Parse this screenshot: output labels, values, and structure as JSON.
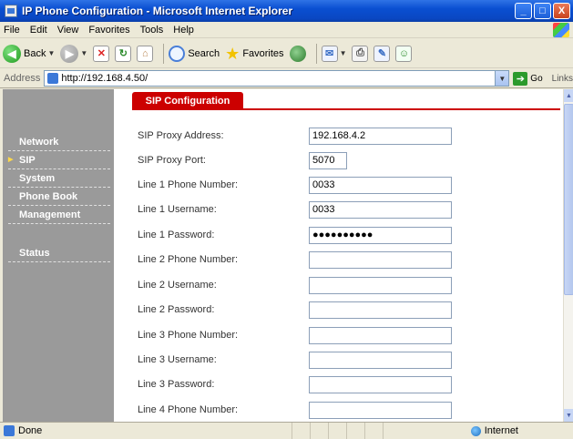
{
  "window": {
    "title": "IP Phone Configuration - Microsoft Internet Explorer",
    "minimize": "_",
    "maximize": "□",
    "close": "X"
  },
  "menubar": {
    "items": [
      "File",
      "Edit",
      "View",
      "Favorites",
      "Tools",
      "Help"
    ]
  },
  "toolbar": {
    "back": "Back",
    "search": "Search",
    "favorites": "Favorites"
  },
  "addressbar": {
    "label": "Address",
    "url": "http://192.168.4.50/",
    "go": "Go",
    "links": "Links"
  },
  "sidebar": {
    "items": [
      {
        "label": "Network",
        "active": false
      },
      {
        "label": "SIP",
        "active": true
      },
      {
        "label": "System",
        "active": false
      },
      {
        "label": "Phone Book",
        "active": false
      },
      {
        "label": "Management",
        "active": false
      },
      {
        "label": "Status",
        "active": false
      }
    ]
  },
  "main": {
    "tab": "SIP Configuration",
    "fields": [
      {
        "label": "SIP Proxy Address:",
        "value": "192.168.4.2"
      },
      {
        "label": "SIP Proxy Port:",
        "value": "5070"
      },
      {
        "label": "Line 1 Phone Number:",
        "value": "0033"
      },
      {
        "label": "Line 1 Username:",
        "value": "0033"
      },
      {
        "label": "Line 1 Password:",
        "value": "●●●●●●●●●●"
      },
      {
        "label": "Line 2 Phone Number:",
        "value": ""
      },
      {
        "label": "Line 2 Username:",
        "value": ""
      },
      {
        "label": "Line 2 Password:",
        "value": ""
      },
      {
        "label": "Line 3 Phone Number:",
        "value": ""
      },
      {
        "label": "Line 3 Username:",
        "value": ""
      },
      {
        "label": "Line 3 Password:",
        "value": ""
      },
      {
        "label": "Line 4 Phone Number:",
        "value": ""
      }
    ]
  },
  "statusbar": {
    "text": "Done",
    "zone": "Internet"
  },
  "colors": {
    "accent": "#cc0000",
    "sidebar": "#9a9a9a",
    "titlebar": "#0a4fd1"
  }
}
